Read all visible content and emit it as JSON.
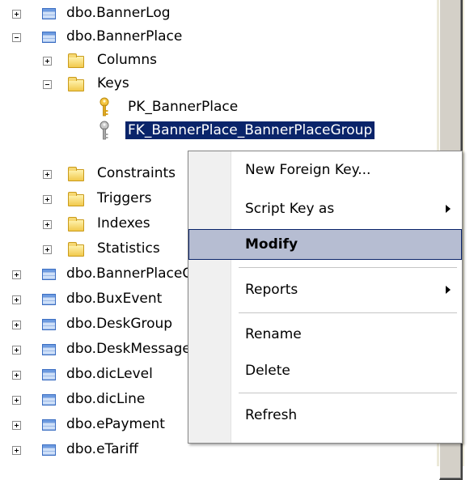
{
  "tree": {
    "items": [
      {
        "label": "dbo.BannerLog",
        "icon": "table-icon",
        "toggle": "plus"
      },
      {
        "label": "dbo.BannerPlace",
        "icon": "table-icon",
        "toggle": "minus"
      },
      {
        "label": "Columns",
        "icon": "folder-icon",
        "toggle": "plus"
      },
      {
        "label": "Keys",
        "icon": "folder-icon",
        "toggle": "minus"
      },
      {
        "label": "PK_BannerPlace",
        "icon": "primary-key-icon"
      },
      {
        "label": "FK_BannerPlace_BannerPlaceGroup",
        "icon": "foreign-key-icon",
        "selected": true
      },
      {
        "label": "Constraints",
        "icon": "folder-icon",
        "toggle": "plus"
      },
      {
        "label": "Triggers",
        "icon": "folder-icon",
        "toggle": "plus"
      },
      {
        "label": "Indexes",
        "icon": "folder-icon",
        "toggle": "plus"
      },
      {
        "label": "Statistics",
        "icon": "folder-icon",
        "toggle": "plus"
      },
      {
        "label": "dbo.BannerPlaceGroup",
        "icon": "table-icon",
        "toggle": "plus"
      },
      {
        "label": "dbo.BuxEvent",
        "icon": "table-icon",
        "toggle": "plus"
      },
      {
        "label": "dbo.DeskGroup",
        "icon": "table-icon",
        "toggle": "plus"
      },
      {
        "label": "dbo.DeskMessage",
        "icon": "table-icon",
        "toggle": "plus"
      },
      {
        "label": "dbo.dicLevel",
        "icon": "table-icon",
        "toggle": "plus"
      },
      {
        "label": "dbo.dicLine",
        "icon": "table-icon",
        "toggle": "plus"
      },
      {
        "label": "dbo.ePayment",
        "icon": "table-icon",
        "toggle": "plus"
      },
      {
        "label": "dbo.eTariff",
        "icon": "table-icon",
        "toggle": "plus"
      }
    ]
  },
  "context_menu": {
    "new_foreign_key": "New Foreign Key...",
    "script_key_as": "Script Key as",
    "modify": "Modify",
    "reports": "Reports",
    "rename": "Rename",
    "delete": "Delete",
    "refresh": "Refresh"
  },
  "colors": {
    "selection": "#0a246a",
    "menu_highlight": "#b6bdd2",
    "scrollbar": "#d4d0c8"
  }
}
